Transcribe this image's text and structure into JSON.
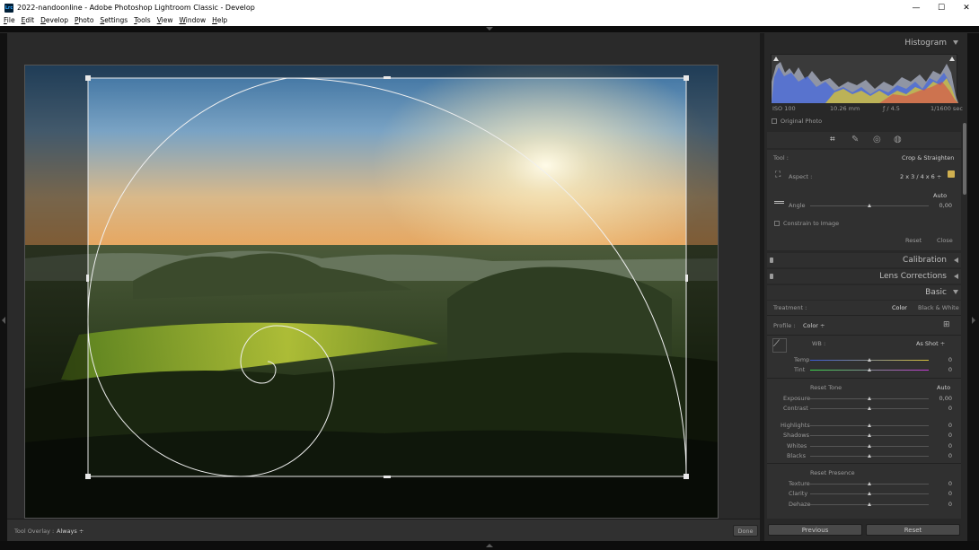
{
  "window": {
    "title": "2022-nandoonline - Adobe Photoshop Lightroom Classic - Develop",
    "app_icon": "Lrc",
    "minimize": "—",
    "maximize": "☐",
    "close": "✕"
  },
  "menu": [
    "File",
    "Edit",
    "Develop",
    "Photo",
    "Settings",
    "Tools",
    "View",
    "Window",
    "Help"
  ],
  "toolbar": {
    "overlay_label": "Tool Overlay :",
    "overlay_value": "Always ÷",
    "done_label": "Done"
  },
  "histogram": {
    "title": "Histogram",
    "iso": "ISO 100",
    "focal": "10.26 mm",
    "aperture": "ƒ / 4.5",
    "shutter": "1/1600 sec",
    "original_photo": "Original Photo"
  },
  "crop": {
    "tool_label": "Tool :",
    "tool_name": "Crop & Straighten",
    "aspect_label": "Aspect :",
    "aspect_value": "2 x 3  /  4 x 6 ÷",
    "auto_label": "Auto",
    "angle_label": "Angle",
    "angle_value": "0,00",
    "angle_level": 0.5,
    "constrain_label": "Constrain to Image",
    "reset_label": "Reset",
    "close_label": "Close"
  },
  "sections": {
    "calibration": "Calibration",
    "lens": "Lens Corrections",
    "basic": "Basic"
  },
  "basic": {
    "treatment_label": "Treatment :",
    "treatment_color": "Color",
    "treatment_bw": "Black & White",
    "profile_label": "Profile :",
    "profile_value": "Color ÷",
    "wb_label": "WB :",
    "wb_value": "As Shot ÷",
    "reset_tone": "Reset Tone",
    "auto": "Auto",
    "reset_presence": "Reset Presence",
    "sliders_wb": [
      {
        "label": "Temp",
        "value": "0",
        "level": 0.5
      },
      {
        "label": "Tint",
        "value": "0",
        "level": 0.5
      }
    ],
    "sliders_tone1": [
      {
        "label": "Exposure",
        "value": "0,00",
        "level": 0.5
      },
      {
        "label": "Contrast",
        "value": "0",
        "level": 0.5
      }
    ],
    "sliders_tone2": [
      {
        "label": "Highlights",
        "value": "0",
        "level": 0.5
      },
      {
        "label": "Shadows",
        "value": "0",
        "level": 0.5
      },
      {
        "label": "Whites",
        "value": "0",
        "level": 0.5
      },
      {
        "label": "Blacks",
        "value": "0",
        "level": 0.5
      }
    ],
    "sliders_presence": [
      {
        "label": "Texture",
        "value": "0",
        "level": 0.5
      },
      {
        "label": "Clarity",
        "value": "0",
        "level": 0.5
      },
      {
        "label": "Dehaze",
        "value": "0",
        "level": 0.5
      }
    ]
  },
  "nav": {
    "previous": "Previous",
    "reset": "Reset"
  }
}
